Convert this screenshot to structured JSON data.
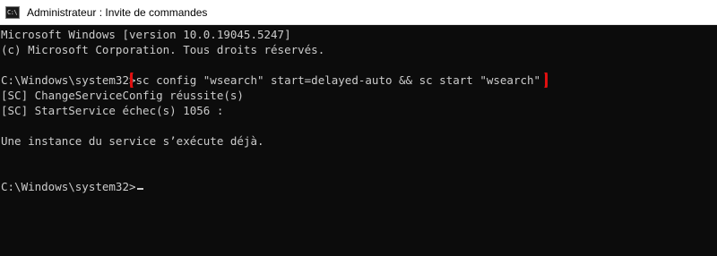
{
  "window": {
    "title": "Administrateur : Invite de commandes",
    "icon": "cmd-icon",
    "icon_glyph": "C:\\"
  },
  "console": {
    "lines": [
      "Microsoft Windows [version 10.0.19045.5247]",
      "(c) Microsoft Corporation. Tous droits réservés.",
      "",
      "",
      "[SC] ChangeServiceConfig réussite(s)",
      "[SC] StartService échec(s) 1056 :",
      "",
      "Une instance du service s’exécute déjà.",
      "",
      "",
      ""
    ],
    "command_prompt": "C:\\Windows\\system32>",
    "command_text": "sc config \"wsearch\" start=delayed-auto && sc start \"wsearch\"",
    "final_prompt": "C:\\Windows\\system32>"
  },
  "annotation": {
    "highlight_color": "#e01010"
  }
}
